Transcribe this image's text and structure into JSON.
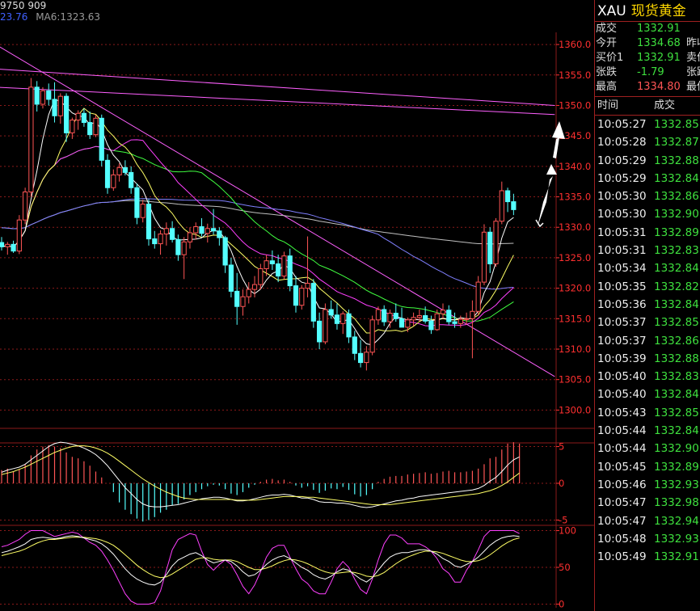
{
  "header": {
    "volume_text": "9750 909",
    "ma_partial": "23.76",
    "ma6_label": "MA6:1323.63"
  },
  "instrument": {
    "symbol": "XAU",
    "name": "现货黄金"
  },
  "quote": [
    {
      "label": "成交",
      "value": "1332.91",
      "right_label": ""
    },
    {
      "label": "今开",
      "value": "1334.68",
      "right_label": "昨收"
    },
    {
      "label": "买价1",
      "value": "1332.91",
      "right_label": "卖价"
    },
    {
      "label": "张跌",
      "value": "-1.79",
      "right_label": "张跌"
    },
    {
      "label": "最高",
      "value": "1334.80",
      "right_label": "最低"
    }
  ],
  "ticks_header": {
    "time": "时间",
    "price": "成交"
  },
  "ticks": [
    {
      "time": "10:05:27",
      "price": "1332.85"
    },
    {
      "time": "10:05:28",
      "price": "1332.87"
    },
    {
      "time": "10:05:29",
      "price": "1332.88"
    },
    {
      "time": "10:05:29",
      "price": "1332.84"
    },
    {
      "time": "10:05:30",
      "price": "1332.86"
    },
    {
      "time": "10:05:30",
      "price": "1332.90"
    },
    {
      "time": "10:05:31",
      "price": "1332.89"
    },
    {
      "time": "10:05:31",
      "price": "1332.83"
    },
    {
      "time": "10:05:34",
      "price": "1332.84"
    },
    {
      "time": "10:05:35",
      "price": "1332.82"
    },
    {
      "time": "10:05:36",
      "price": "1332.84"
    },
    {
      "time": "10:05:37",
      "price": "1332.85"
    },
    {
      "time": "10:05:37",
      "price": "1332.86"
    },
    {
      "time": "10:05:39",
      "price": "1332.88"
    },
    {
      "time": "10:05:40",
      "price": "1332.83"
    },
    {
      "time": "10:05:40",
      "price": "1332.84"
    },
    {
      "time": "10:05:43",
      "price": "1332.85"
    },
    {
      "time": "10:05:44",
      "price": "1332.84"
    },
    {
      "time": "10:05:44",
      "price": "1332.90"
    },
    {
      "time": "10:05:45",
      "price": "1332.89"
    },
    {
      "time": "10:05:46",
      "price": "1332.93"
    },
    {
      "time": "10:05:47",
      "price": "1332.98"
    },
    {
      "time": "10:05:47",
      "price": "1332.94"
    },
    {
      "time": "10:05:48",
      "price": "1332.93"
    },
    {
      "time": "10:05:49",
      "price": "1332.91"
    }
  ],
  "price_axis": {
    "labels": [
      "1360.0",
      "1355.0",
      "1350.0",
      "1345.0",
      "1340.0",
      "1335.0",
      "1330.0",
      "1325.0",
      "1320.0",
      "1315.0",
      "1310.0",
      "1305.0",
      "1300.0"
    ],
    "values": [
      1360,
      1355,
      1350,
      1345,
      1340,
      1335,
      1330,
      1325,
      1320,
      1315,
      1310,
      1305,
      1300
    ]
  },
  "macd_axis": {
    "labels": [
      "5",
      "0",
      "-5"
    ],
    "values": [
      5,
      0,
      -5
    ]
  },
  "kdj_axis": {
    "labels": [
      "100",
      "50",
      "0"
    ],
    "values": [
      100,
      50,
      0
    ]
  },
  "colors": {
    "up": "#ff5555",
    "down": "#54ffff",
    "grid": "#8b1a1a",
    "axis_text": "#ff3030",
    "ma5": "#ffffff",
    "ma10": "#ffff66",
    "ma20": "#ff40ff",
    "ma30": "#40ff40",
    "ma60": "#8080ff",
    "ma120": "#c0c0c0",
    "trend": "#ff60ff"
  },
  "candles": [
    [
      1327.5,
      1328.4,
      1326.2,
      1326.8
    ],
    [
      1326.8,
      1327.6,
      1325.5,
      1327.2
    ],
    [
      1327.2,
      1327.8,
      1325.8,
      1326.1
    ],
    [
      1326.1,
      1332.0,
      1325.6,
      1331.2
    ],
    [
      1331.2,
      1336.5,
      1330.5,
      1335.8
    ],
    [
      1335.8,
      1354.5,
      1335.0,
      1353.0
    ],
    [
      1353.0,
      1354.0,
      1349.0,
      1350.2
    ],
    [
      1350.2,
      1353.0,
      1349.5,
      1352.4
    ],
    [
      1352.4,
      1353.6,
      1350.0,
      1351.0
    ],
    [
      1351.0,
      1353.8,
      1347.2,
      1348.3
    ],
    [
      1348.3,
      1352.0,
      1347.0,
      1351.5
    ],
    [
      1351.5,
      1352.0,
      1344.0,
      1345.5
    ],
    [
      1345.5,
      1348.0,
      1344.5,
      1347.6
    ],
    [
      1347.6,
      1349.2,
      1346.0,
      1348.7
    ],
    [
      1348.7,
      1349.5,
      1346.5,
      1347.2
    ],
    [
      1347.2,
      1349.0,
      1344.5,
      1345.2
    ],
    [
      1345.2,
      1348.5,
      1344.8,
      1347.9
    ],
    [
      1347.9,
      1348.5,
      1340.0,
      1341.0
    ],
    [
      1341.0,
      1342.0,
      1335.5,
      1336.5
    ],
    [
      1336.5,
      1339.5,
      1336.0,
      1338.6
    ],
    [
      1338.6,
      1340.5,
      1337.5,
      1339.8
    ],
    [
      1339.8,
      1341.0,
      1338.5,
      1339.0
    ],
    [
      1339.0,
      1340.0,
      1335.5,
      1336.5
    ],
    [
      1336.5,
      1337.2,
      1330.5,
      1331.6
    ],
    [
      1331.6,
      1334.5,
      1330.8,
      1333.8
    ],
    [
      1333.8,
      1334.6,
      1327.0,
      1328.1
    ],
    [
      1328.1,
      1329.4,
      1326.5,
      1327.3
    ],
    [
      1327.3,
      1329.5,
      1325.5,
      1328.9
    ],
    [
      1328.9,
      1330.8,
      1327.0,
      1329.8
    ],
    [
      1329.8,
      1331.0,
      1327.5,
      1328.0
    ],
    [
      1328.0,
      1328.8,
      1324.5,
      1325.5
    ],
    [
      1325.5,
      1328.4,
      1321.5,
      1327.6
    ],
    [
      1327.6,
      1330.0,
      1326.5,
      1329.1
    ],
    [
      1329.1,
      1330.8,
      1328.0,
      1330.1
    ],
    [
      1330.1,
      1331.5,
      1328.5,
      1329.0
    ],
    [
      1329.0,
      1330.6,
      1327.5,
      1329.8
    ],
    [
      1329.8,
      1333.0,
      1328.8,
      1329.4
    ],
    [
      1329.4,
      1330.0,
      1327.0,
      1328.3
    ],
    [
      1328.3,
      1328.6,
      1322.5,
      1323.8
    ],
    [
      1323.8,
      1325.0,
      1318.5,
      1319.5
    ],
    [
      1319.5,
      1322.5,
      1314.0,
      1317.0
    ],
    [
      1317.0,
      1319.8,
      1315.5,
      1318.6
    ],
    [
      1318.6,
      1321.0,
      1317.5,
      1319.8
    ],
    [
      1319.8,
      1322.0,
      1318.5,
      1320.6
    ],
    [
      1320.6,
      1324.0,
      1319.8,
      1323.2
    ],
    [
      1323.2,
      1325.5,
      1322.0,
      1324.5
    ],
    [
      1324.5,
      1326.2,
      1323.0,
      1324.0
    ],
    [
      1324.0,
      1325.5,
      1321.0,
      1322.0
    ],
    [
      1322.0,
      1326.0,
      1321.5,
      1325.3
    ],
    [
      1325.3,
      1326.5,
      1319.5,
      1320.4
    ],
    [
      1320.4,
      1322.0,
      1316.0,
      1317.2
    ],
    [
      1317.2,
      1320.5,
      1316.5,
      1320.0
    ],
    [
      1320.0,
      1328.5,
      1318.5,
      1320.8
    ],
    [
      1320.8,
      1321.5,
      1313.5,
      1314.6
    ],
    [
      1314.6,
      1316.0,
      1310.0,
      1311.2
    ],
    [
      1311.2,
      1317.5,
      1310.8,
      1316.5
    ],
    [
      1316.5,
      1318.0,
      1315.0,
      1315.6
    ],
    [
      1315.6,
      1317.5,
      1313.2,
      1314.2
    ],
    [
      1314.2,
      1316.2,
      1312.5,
      1315.8
    ],
    [
      1315.8,
      1316.5,
      1311.0,
      1312.0
    ],
    [
      1312.0,
      1313.0,
      1308.2,
      1309.3
    ],
    [
      1309.3,
      1311.5,
      1307.0,
      1307.8
    ],
    [
      1307.8,
      1310.5,
      1306.5,
      1309.5
    ],
    [
      1309.5,
      1315.5,
      1309.0,
      1314.8
    ],
    [
      1314.8,
      1317.0,
      1314.0,
      1316.5
    ],
    [
      1316.5,
      1317.2,
      1313.8,
      1314.5
    ],
    [
      1314.5,
      1316.5,
      1313.5,
      1315.9
    ],
    [
      1315.9,
      1317.5,
      1314.5,
      1315.0
    ],
    [
      1315.0,
      1316.8,
      1314.0,
      1313.6
    ],
    [
      1313.6,
      1315.2,
      1312.8,
      1314.8
    ],
    [
      1314.8,
      1316.0,
      1313.8,
      1315.2
    ],
    [
      1315.2,
      1316.5,
      1314.5,
      1315.5
    ],
    [
      1315.5,
      1317.0,
      1314.2,
      1314.6
    ],
    [
      1314.6,
      1315.5,
      1312.5,
      1313.2
    ],
    [
      1313.2,
      1316.5,
      1313.0,
      1315.8
    ],
    [
      1315.8,
      1317.5,
      1315.0,
      1316.4
    ],
    [
      1316.4,
      1317.2,
      1314.0,
      1314.5
    ],
    [
      1314.5,
      1316.0,
      1313.5,
      1314.2
    ],
    [
      1314.2,
      1315.5,
      1313.5,
      1314.9
    ],
    [
      1314.9,
      1316.0,
      1314.0,
      1315.0
    ],
    [
      1315.0,
      1318.0,
      1308.5,
      1316.2
    ],
    [
      1316.2,
      1322.0,
      1315.5,
      1321.0
    ],
    [
      1321.0,
      1330.5,
      1320.5,
      1329.2
    ],
    [
      1329.2,
      1330.0,
      1322.5,
      1324.0
    ],
    [
      1324.0,
      1331.5,
      1323.5,
      1331.0
    ],
    [
      1331.0,
      1337.5,
      1330.5,
      1336.0
    ],
    [
      1336.0,
      1336.5,
      1332.5,
      1334.2
    ],
    [
      1334.2,
      1335.5,
      1332.0,
      1332.9
    ]
  ],
  "macd_hist": [
    1.8,
    2.0,
    1.6,
    1.9,
    2.6,
    3.8,
    4.6,
    5.0,
    5.2,
    5.0,
    4.8,
    4.2,
    3.6,
    3.4,
    3.0,
    2.4,
    1.6,
    0.8,
    0.0,
    -1.2,
    -2.6,
    -3.6,
    -4.2,
    -4.8,
    -5.2,
    -5.0,
    -4.6,
    -4.0,
    -3.6,
    -3.0,
    -2.8,
    -2.2,
    -1.6,
    -1.2,
    -0.8,
    -0.4,
    -0.2,
    -0.3,
    -0.8,
    -1.4,
    -1.6,
    -1.2,
    -0.6,
    -0.2,
    0.2,
    0.5,
    0.6,
    0.4,
    0.5,
    0.2,
    -0.3,
    -0.6,
    -0.4,
    -0.9,
    -1.3,
    -1.0,
    -0.7,
    -0.8,
    -0.5,
    -0.9,
    -1.5,
    -1.8,
    -1.6,
    -0.8,
    0.2,
    0.6,
    0.9,
    1.0,
    1.0,
    1.2,
    1.3,
    1.4,
    1.5,
    1.3,
    1.4,
    1.6,
    1.7,
    1.5,
    1.5,
    1.6,
    1.7,
    2.0,
    2.6,
    3.4,
    3.6,
    4.6,
    5.4,
    5.6,
    5.4
  ],
  "macd_dif": [
    1.5,
    1.8,
    2.0,
    2.2,
    2.6,
    3.2,
    3.8,
    4.4,
    5.0,
    5.4,
    5.6,
    5.5,
    5.3,
    5.1,
    4.8,
    4.4,
    3.9,
    3.2,
    2.4,
    1.4,
    0.4,
    -0.6,
    -1.4,
    -2.2,
    -2.8,
    -3.1,
    -3.2,
    -3.2,
    -3.1,
    -3.0,
    -2.9,
    -2.7,
    -2.5,
    -2.3,
    -2.1,
    -2.0,
    -1.9,
    -1.9,
    -2.0,
    -2.2,
    -2.4,
    -2.4,
    -2.3,
    -2.1,
    -1.9,
    -1.7,
    -1.6,
    -1.6,
    -1.5,
    -1.6,
    -1.8,
    -2.0,
    -2.0,
    -2.2,
    -2.5,
    -2.6,
    -2.6,
    -2.7,
    -2.7,
    -2.8,
    -3.0,
    -3.2,
    -3.3,
    -3.2,
    -3.0,
    -2.8,
    -2.6,
    -2.4,
    -2.3,
    -2.1,
    -2.0,
    -1.8,
    -1.7,
    -1.6,
    -1.5,
    -1.4,
    -1.3,
    -1.2,
    -1.1,
    -1.0,
    -0.9,
    -0.7,
    -0.3,
    0.3,
    0.8,
    1.6,
    2.5,
    3.2,
    3.6
  ],
  "macd_dea": [
    1.2,
    1.4,
    1.6,
    1.9,
    2.2,
    2.6,
    3.0,
    3.4,
    3.8,
    4.2,
    4.5,
    4.8,
    5.0,
    5.1,
    5.1,
    5.0,
    4.8,
    4.5,
    4.1,
    3.6,
    3.0,
    2.4,
    1.8,
    1.2,
    0.6,
    0.1,
    -0.4,
    -0.8,
    -1.2,
    -1.5,
    -1.8,
    -2.0,
    -2.1,
    -2.2,
    -2.2,
    -2.2,
    -2.2,
    -2.2,
    -2.2,
    -2.2,
    -2.3,
    -2.3,
    -2.3,
    -2.3,
    -2.2,
    -2.1,
    -2.0,
    -1.9,
    -1.8,
    -1.8,
    -1.8,
    -1.8,
    -1.9,
    -1.9,
    -2.0,
    -2.1,
    -2.2,
    -2.3,
    -2.4,
    -2.5,
    -2.6,
    -2.7,
    -2.8,
    -2.9,
    -2.9,
    -2.9,
    -2.9,
    -2.8,
    -2.7,
    -2.6,
    -2.5,
    -2.4,
    -2.3,
    -2.2,
    -2.1,
    -2.0,
    -1.9,
    -1.8,
    -1.7,
    -1.6,
    -1.5,
    -1.4,
    -1.2,
    -1.0,
    -0.7,
    -0.3,
    0.2,
    0.8,
    1.4
  ],
  "kdj_k": [
    70,
    72,
    75,
    78,
    82,
    88,
    90,
    91,
    90,
    89,
    90,
    92,
    93,
    92,
    90,
    88,
    86,
    82,
    76,
    68,
    58,
    48,
    40,
    34,
    30,
    27,
    26,
    30,
    40,
    52,
    60,
    64,
    68,
    70,
    66,
    60,
    56,
    58,
    60,
    58,
    52,
    44,
    38,
    40,
    46,
    54,
    60,
    64,
    66,
    62,
    56,
    50,
    46,
    40,
    36,
    34,
    38,
    44,
    48,
    46,
    40,
    34,
    30,
    36,
    46,
    56,
    64,
    68,
    70,
    70,
    72,
    74,
    74,
    72,
    68,
    62,
    58,
    52,
    50,
    54,
    58,
    64,
    72,
    80,
    86,
    90,
    92,
    93,
    92
  ],
  "kdj_d": [
    66,
    68,
    70,
    72,
    75,
    79,
    83,
    86,
    88,
    88,
    89,
    90,
    91,
    91,
    91,
    90,
    89,
    87,
    84,
    80,
    74,
    67,
    60,
    53,
    47,
    42,
    38,
    36,
    37,
    41,
    46,
    51,
    56,
    61,
    63,
    63,
    61,
    60,
    60,
    60,
    58,
    54,
    50,
    47,
    47,
    49,
    52,
    56,
    59,
    61,
    60,
    58,
    55,
    51,
    47,
    44,
    42,
    42,
    43,
    44,
    43,
    41,
    38,
    37,
    39,
    43,
    49,
    55,
    60,
    64,
    67,
    70,
    72,
    72,
    71,
    69,
    66,
    63,
    60,
    58,
    58,
    59,
    62,
    67,
    73,
    79,
    84,
    88,
    90
  ],
  "kdj_j": [
    78,
    80,
    84,
    88,
    95,
    100,
    100,
    100,
    96,
    92,
    94,
    96,
    98,
    96,
    90,
    84,
    80,
    72,
    60,
    46,
    30,
    14,
    4,
    0,
    0,
    0,
    2,
    18,
    46,
    74,
    88,
    92,
    96,
    94,
    72,
    54,
    46,
    54,
    60,
    54,
    40,
    24,
    14,
    26,
    44,
    64,
    76,
    80,
    80,
    64,
    48,
    34,
    28,
    18,
    14,
    14,
    30,
    48,
    58,
    50,
    34,
    20,
    14,
    34,
    60,
    82,
    94,
    94,
    90,
    82,
    82,
    82,
    78,
    72,
    62,
    48,
    42,
    30,
    30,
    46,
    58,
    74,
    92,
    100,
    100,
    100,
    100,
    100,
    96
  ]
}
